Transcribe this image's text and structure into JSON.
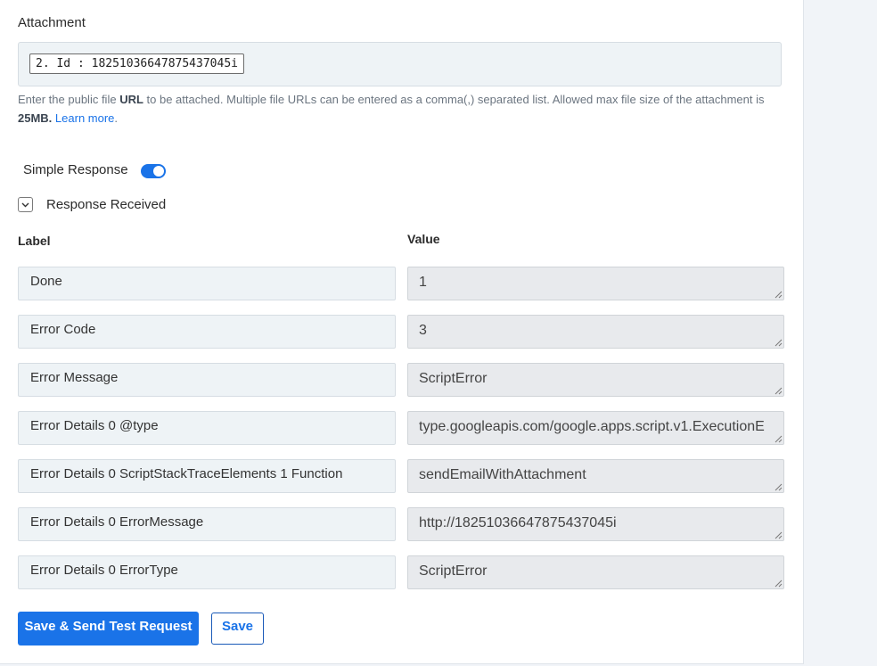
{
  "attachment": {
    "title": "Attachment",
    "token": "2. Id : 182510366478754370​45i",
    "help_before_url": "Enter the public file ",
    "help_url": "URL",
    "help_middle": " to be attached. Multiple file URLs can be entered as a comma(,) separated list. Allowed max file size of the attachment is ",
    "help_size": "25MB.",
    "help_link": "Learn more",
    "help_end": "."
  },
  "simple_response": {
    "label": "Simple Response",
    "enabled": true,
    "accent": "#1a73e8"
  },
  "response_received": {
    "label": "Response Received",
    "icon": "chevron-down-icon",
    "label_header": "Label",
    "value_header": "Value",
    "rows": [
      {
        "label": "Done",
        "value": "1"
      },
      {
        "label": "Error Code",
        "value": "3"
      },
      {
        "label": "Error Message",
        "value": "ScriptError"
      },
      {
        "label": "Error Details 0 @type",
        "value": "type.googleapis.com/google.apps.script.v1.ExecutionE"
      },
      {
        "label": "Error Details 0 ScriptStackTraceElements 1 Function",
        "value": "sendEmailWithAttachment"
      },
      {
        "label": "Error Details 0 ErrorMessage",
        "value": "http://182510366478754370​45i"
      },
      {
        "label": "Error Details 0 ErrorType",
        "value": "ScriptError"
      }
    ]
  },
  "actions": {
    "save_send_label": "Save & Send Test Request",
    "save_label": "Save"
  }
}
